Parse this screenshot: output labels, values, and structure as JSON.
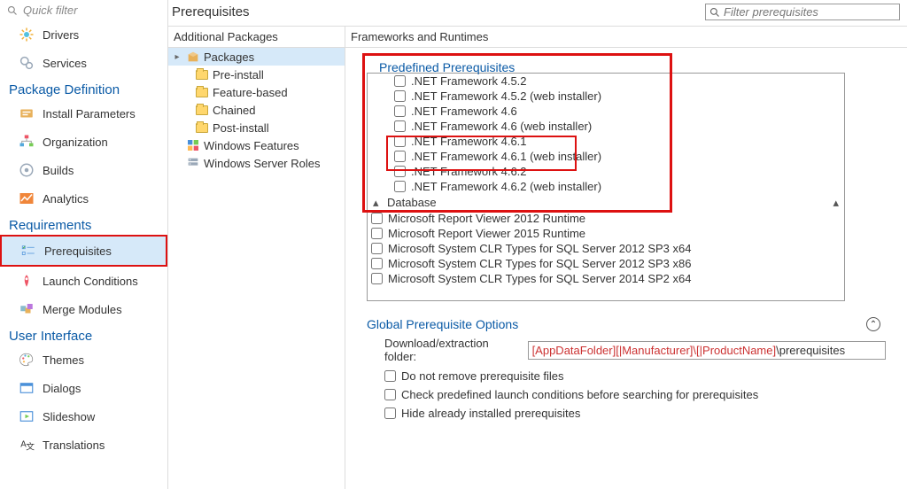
{
  "quick_filter_placeholder": "Quick filter",
  "nav": {
    "items_top": [
      {
        "icon": "drivers",
        "label": "Drivers"
      },
      {
        "icon": "services",
        "label": "Services"
      }
    ],
    "section_pkg_def": "Package Definition",
    "items_pkgdef": [
      {
        "icon": "install-params",
        "label": "Install Parameters"
      },
      {
        "icon": "organization",
        "label": "Organization"
      },
      {
        "icon": "builds",
        "label": "Builds"
      },
      {
        "icon": "analytics",
        "label": "Analytics"
      }
    ],
    "section_req": "Requirements",
    "items_req": [
      {
        "icon": "prerequisites",
        "label": "Prerequisites",
        "selected": true,
        "boxed": true
      },
      {
        "icon": "launch-cond",
        "label": "Launch Conditions"
      },
      {
        "icon": "merge-modules",
        "label": "Merge Modules"
      }
    ],
    "section_ui": "User Interface",
    "items_ui": [
      {
        "icon": "themes",
        "label": "Themes"
      },
      {
        "icon": "dialogs",
        "label": "Dialogs"
      },
      {
        "icon": "slideshow",
        "label": "Slideshow"
      },
      {
        "icon": "translations",
        "label": "Translations"
      }
    ]
  },
  "header": {
    "title": "Prerequisites",
    "filter_placeholder": "Filter prerequisites"
  },
  "tree": {
    "head": "Additional Packages",
    "root": "Packages",
    "children": [
      "Pre-install",
      "Feature-based",
      "Chained",
      "Post-install"
    ],
    "extra": [
      "Windows Features",
      "Windows Server Roles"
    ]
  },
  "frameworks": {
    "head": "Frameworks and Runtimes",
    "fieldset_title": "Predefined Prerequisites",
    "items_framework": [
      ".NET Framework 4.5.2",
      ".NET Framework 4.5.2 (web installer)",
      ".NET Framework 4.6",
      ".NET Framework 4.6 (web installer)",
      ".NET Framework 4.6.1",
      ".NET Framework 4.6.1 (web installer)",
      ".NET Framework 4.6.2",
      ".NET Framework 4.6.2 (web installer)"
    ],
    "db_title": "Database",
    "items_db": [
      "Microsoft Report Viewer 2012 Runtime",
      "Microsoft Report Viewer 2015 Runtime",
      "Microsoft System CLR Types for SQL Server 2012 SP3 x64",
      "Microsoft System CLR Types for SQL Server 2012 SP3 x86",
      "Microsoft System CLR Types for SQL Server 2014 SP2 x64"
    ]
  },
  "global": {
    "title": "Global Prerequisite Options",
    "download_label": "Download/extraction folder:",
    "download_var": "[AppDataFolder][|Manufacturer]\\[|ProductName]",
    "download_suffix": "\\prerequisites",
    "chk1": "Do not remove prerequisite files",
    "chk2": "Check predefined launch conditions before searching for prerequisites",
    "chk3": "Hide already installed prerequisites"
  }
}
